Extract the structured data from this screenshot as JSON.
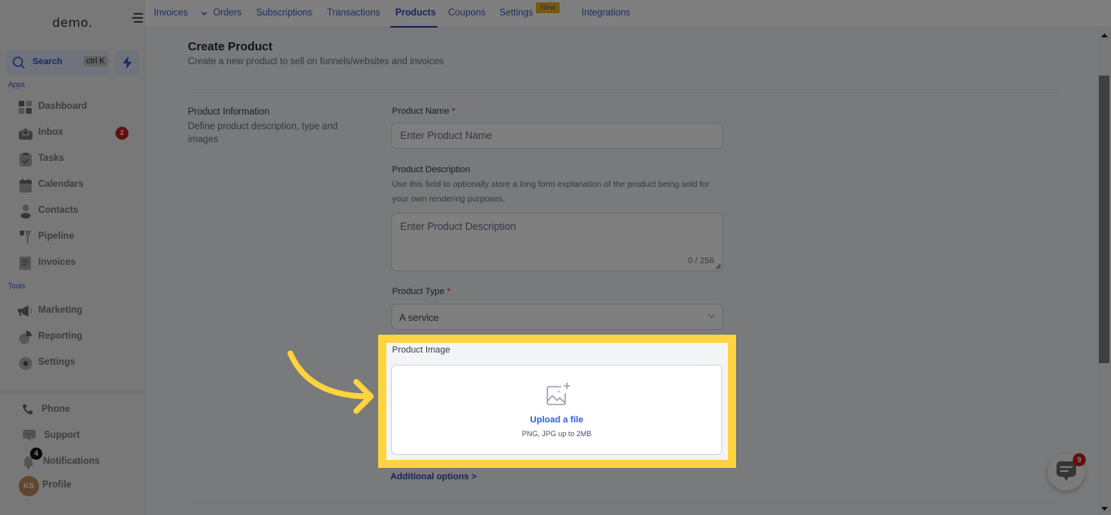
{
  "sidebar": {
    "logo": "demo.",
    "search": {
      "label": "Search",
      "shortcut": "ctrl K"
    },
    "apps_label": "Apps",
    "apps": [
      {
        "label": "Dashboard",
        "icon": "dashboard-icon"
      },
      {
        "label": "Inbox",
        "icon": "inbox-icon",
        "badge": "2"
      },
      {
        "label": "Tasks",
        "icon": "tasks-icon"
      },
      {
        "label": "Calendars",
        "icon": "calendar-icon"
      },
      {
        "label": "Contacts",
        "icon": "contacts-icon"
      },
      {
        "label": "Pipeline",
        "icon": "pipeline-icon"
      },
      {
        "label": "Invoices",
        "icon": "invoices-icon"
      }
    ],
    "tools_label": "Tools",
    "tools": [
      {
        "label": "Marketing",
        "icon": "megaphone-icon"
      },
      {
        "label": "Reporting",
        "icon": "pie-chart-icon"
      },
      {
        "label": "Settings",
        "icon": "gear-icon"
      }
    ],
    "bottom": [
      {
        "label": "Phone",
        "icon": "phone-icon"
      },
      {
        "label": "Support",
        "icon": "support-icon"
      },
      {
        "label": "Notifications",
        "icon": "bell-icon",
        "badge": "4"
      },
      {
        "label": "Profile",
        "avatar_initials": "KS"
      }
    ]
  },
  "topnav": {
    "tabs": [
      {
        "label": "Invoices",
        "has_dropdown": true
      },
      {
        "label": "Orders"
      },
      {
        "label": "Subscriptions"
      },
      {
        "label": "Transactions"
      },
      {
        "label": "Products",
        "active": true
      },
      {
        "label": "Coupons"
      },
      {
        "label": "Settings",
        "badge": "New"
      },
      {
        "label": "Integrations"
      }
    ]
  },
  "page": {
    "title": "Create Product",
    "subtitle": "Create a new product to sell on funnels/websites and invoices",
    "section": {
      "title": "Product Information",
      "description": "Define product description, type and images"
    },
    "fields": {
      "name": {
        "label": "Product Name",
        "required": "*",
        "placeholder": "Enter Product Name",
        "value": ""
      },
      "description": {
        "label": "Product Description",
        "help": "Use this field to optionally store a long form explanation of the product being sold for your own rendering purposes.",
        "placeholder": "Enter Product Description",
        "counter": "0 / 256"
      },
      "type": {
        "label": "Product Type",
        "required": "*",
        "value": "A service"
      },
      "image": {
        "label": "Product Image",
        "upload_link": "Upload a file",
        "hint": "PNG, JPG up to 2MB"
      }
    },
    "additional_options": "Additional options >"
  },
  "chat_widget": {
    "badge": "9"
  },
  "colors": {
    "highlight": "#ffd43f",
    "accent": "#2c49b5",
    "link": "#2f5fe0",
    "badge_red": "#c81e1e",
    "new_badge": "#f4b71a"
  }
}
